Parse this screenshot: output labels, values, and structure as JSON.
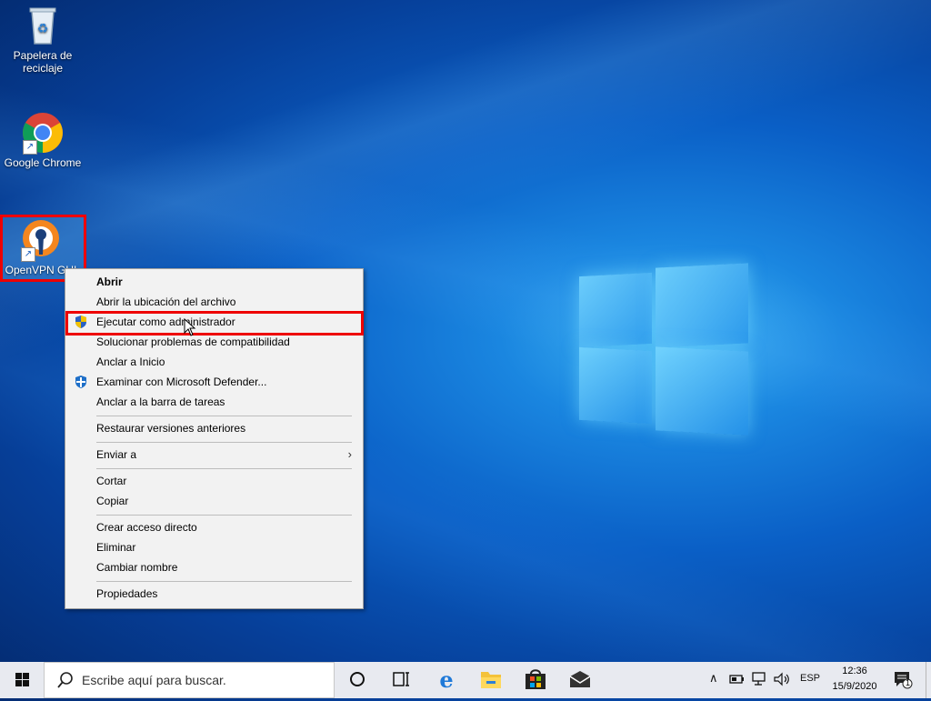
{
  "desktop": {
    "icons": [
      {
        "label_line1": "Papelera de",
        "label_line2": "reciclaje",
        "icon": "recycle-bin-icon"
      },
      {
        "label": "Google Chrome",
        "icon": "chrome-icon"
      },
      {
        "label": "OpenVPN GUI",
        "icon": "openvpn-icon"
      }
    ]
  },
  "context_menu": {
    "items": [
      {
        "label": "Abrir",
        "bold": true
      },
      {
        "label": "Abrir la ubicación del archivo"
      },
      {
        "label": "Ejecutar como administrador",
        "icon": "uac-shield-icon",
        "highlighted": true
      },
      {
        "label": "Solucionar problemas de compatibilidad"
      },
      {
        "label": "Anclar a Inicio"
      },
      {
        "label": "Examinar con Microsoft Defender...",
        "icon": "defender-icon"
      },
      {
        "label": "Anclar a la barra de tareas"
      },
      {
        "label": "Restaurar versiones anteriores"
      },
      {
        "label": "Enviar a",
        "submenu": true
      },
      {
        "label": "Cortar"
      },
      {
        "label": "Copiar"
      },
      {
        "label": "Crear acceso directo"
      },
      {
        "label": "Eliminar"
      },
      {
        "label": "Cambiar nombre"
      },
      {
        "label": "Propiedades"
      }
    ]
  },
  "taskbar": {
    "search_placeholder": "Escribe aquí para buscar.",
    "language": "ESP",
    "time": "12:36",
    "date": "15/9/2020",
    "notification_count": "1"
  },
  "colors": {
    "highlight_border": "#ee0000",
    "taskbar_bg": "#e8eaf0",
    "menu_bg": "#f2f2f2"
  }
}
